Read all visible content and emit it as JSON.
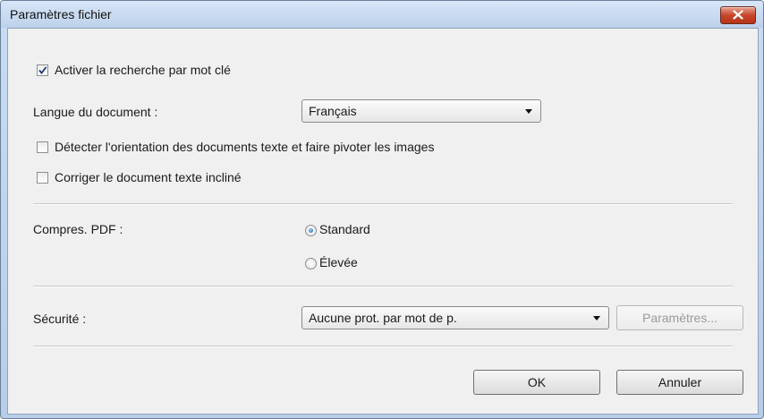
{
  "window": {
    "title": "Paramètres fichier"
  },
  "keyword_search": {
    "label": "Activer la recherche par mot clé",
    "checked": true
  },
  "document_language": {
    "label": "Langue du document :",
    "value": "Français"
  },
  "detect_orientation": {
    "label": "Détecter l'orientation des documents texte et faire pivoter les images",
    "checked": false
  },
  "correct_skew": {
    "label": "Corriger le document texte incliné",
    "checked": false
  },
  "pdf_compression": {
    "label": "Compres. PDF :",
    "options": [
      {
        "label": "Standard",
        "selected": true
      },
      {
        "label": "Élevée",
        "selected": false
      }
    ]
  },
  "security": {
    "label": "Sécurité :",
    "value": "Aucune prot. par mot de p.",
    "settings_button": "Paramètres...",
    "settings_enabled": false
  },
  "footer": {
    "ok_label": "OK",
    "cancel_label": "Annuler"
  }
}
